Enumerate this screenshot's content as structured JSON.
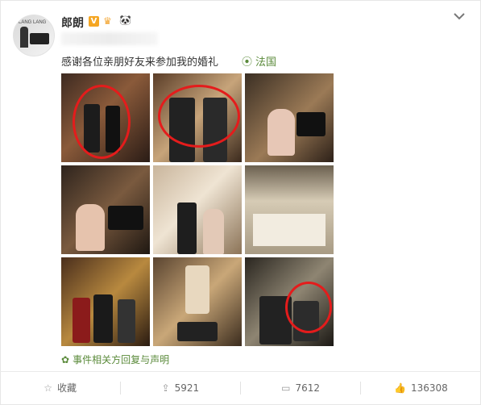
{
  "post": {
    "username": "郎朗",
    "text": "感谢各位亲朋好友来参加我的婚礼",
    "location": "法国",
    "related_link": "事件相关方回复与声明"
  },
  "icons": {
    "verified": "verified-icon",
    "crown": "crown-icon",
    "panda": "panda-icon",
    "location": "location-pin-icon",
    "related": "related-icon",
    "favorite": "star-icon",
    "repost": "repost-icon",
    "comment": "comment-icon",
    "like": "thumbs-up-icon"
  },
  "actions": {
    "favorite_label": "收藏",
    "repost_count": "5921",
    "comment_count": "7612",
    "like_count": "136308"
  },
  "colors": {
    "accent": "#e41c1c",
    "link": "#5a8a3a",
    "verified": "#f5a623"
  }
}
